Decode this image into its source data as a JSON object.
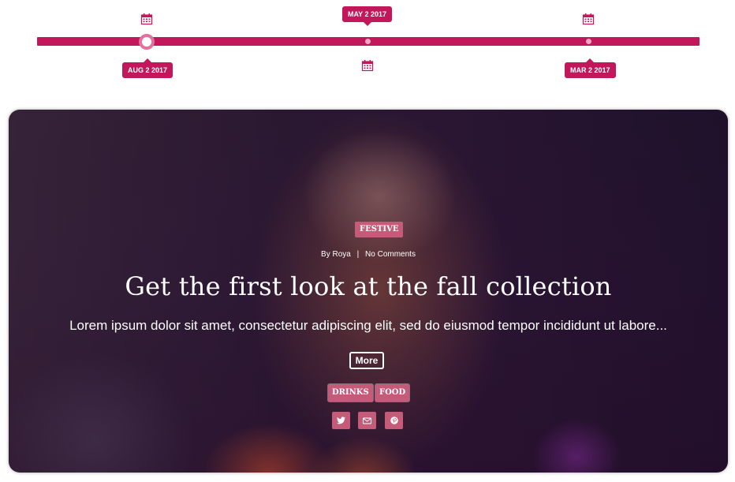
{
  "timeline": {
    "items": [
      {
        "date": "AUG 2 2017",
        "active": true
      },
      {
        "date": "MAY 2 2017",
        "active": false
      },
      {
        "date": "MAR 2 2017",
        "active": false
      }
    ],
    "colors": {
      "bar": "#c2185b",
      "active_ring": "#e3709f",
      "dot": "#f4a6c5"
    }
  },
  "post": {
    "category": "FESTIVE",
    "author_prefix": "By",
    "author": "Roya",
    "separator": "|",
    "comments": "No Comments",
    "title": "Get the first look at the fall collection",
    "excerpt": "Lorem ipsum dolor sit amet, consectetur adipiscing elit, sed do eiusmod tempor incididunt ut labore...",
    "more_label": "More",
    "tags": [
      "DRINKS",
      "FOOD"
    ],
    "share_icons": [
      "twitter-icon",
      "email-icon",
      "pinterest-icon"
    ],
    "accent_color": "#c55b79"
  }
}
